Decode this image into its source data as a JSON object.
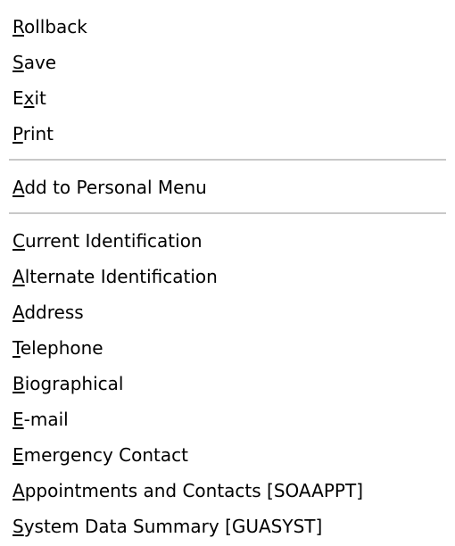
{
  "menu": {
    "groups": [
      {
        "items": [
          {
            "mnemonic": "R",
            "rest": "ollback",
            "pre": ""
          },
          {
            "mnemonic": "S",
            "rest": "ave",
            "pre": ""
          },
          {
            "mnemonic": "x",
            "rest": "it",
            "pre": "E"
          },
          {
            "mnemonic": "P",
            "rest": "rint",
            "pre": ""
          }
        ]
      },
      {
        "items": [
          {
            "mnemonic": "A",
            "rest": "dd to Personal Menu",
            "pre": ""
          }
        ]
      },
      {
        "items": [
          {
            "mnemonic": "C",
            "rest": "urrent Identification",
            "pre": ""
          },
          {
            "mnemonic": "A",
            "rest": "lternate Identification",
            "pre": ""
          },
          {
            "mnemonic": "A",
            "rest": "ddress",
            "pre": ""
          },
          {
            "mnemonic": "T",
            "rest": "elephone",
            "pre": ""
          },
          {
            "mnemonic": "B",
            "rest": "iographical",
            "pre": ""
          },
          {
            "mnemonic": "E",
            "rest": "-mail",
            "pre": ""
          },
          {
            "mnemonic": "E",
            "rest": "mergency Contact",
            "pre": ""
          },
          {
            "mnemonic": "A",
            "rest": "ppointments and Contacts [SOAAPPT]",
            "pre": ""
          },
          {
            "mnemonic": "S",
            "rest": "ystem Data Summary [GUASYST]",
            "pre": ""
          }
        ]
      }
    ]
  },
  "colors": {
    "background": "#ffffff",
    "text": "#000000",
    "separator": "#c8c8c8"
  }
}
